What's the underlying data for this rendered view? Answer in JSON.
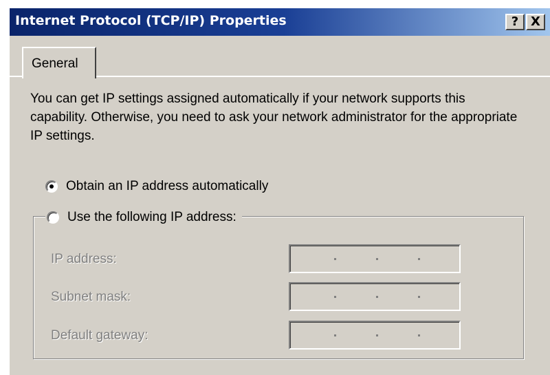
{
  "window": {
    "title": "Internet Protocol (TCP/IP) Properties",
    "help_label": "?",
    "close_label": "X"
  },
  "tabs": [
    {
      "label": "General",
      "selected": true
    }
  ],
  "general": {
    "intro": "You can get IP settings assigned automatically if your network supports this capability. Otherwise, you need to ask your network administrator for the appropriate IP settings.",
    "radio_auto": {
      "label": "Obtain an IP address automatically",
      "checked": true
    },
    "radio_manual": {
      "label": "Use the following IP address:",
      "checked": false
    },
    "fields": [
      {
        "label": "IP address:",
        "value": ".  .  .",
        "enabled": false
      },
      {
        "label": "Subnet mask:",
        "value": ".  .  .",
        "enabled": false
      },
      {
        "label": "Default gateway:",
        "value": ".  .  .",
        "enabled": false
      }
    ]
  },
  "colors": {
    "titlebar_start": "#0a246a",
    "titlebar_end": "#a6caf0",
    "face": "#d4d0c8",
    "disabled_text": "#808080"
  }
}
